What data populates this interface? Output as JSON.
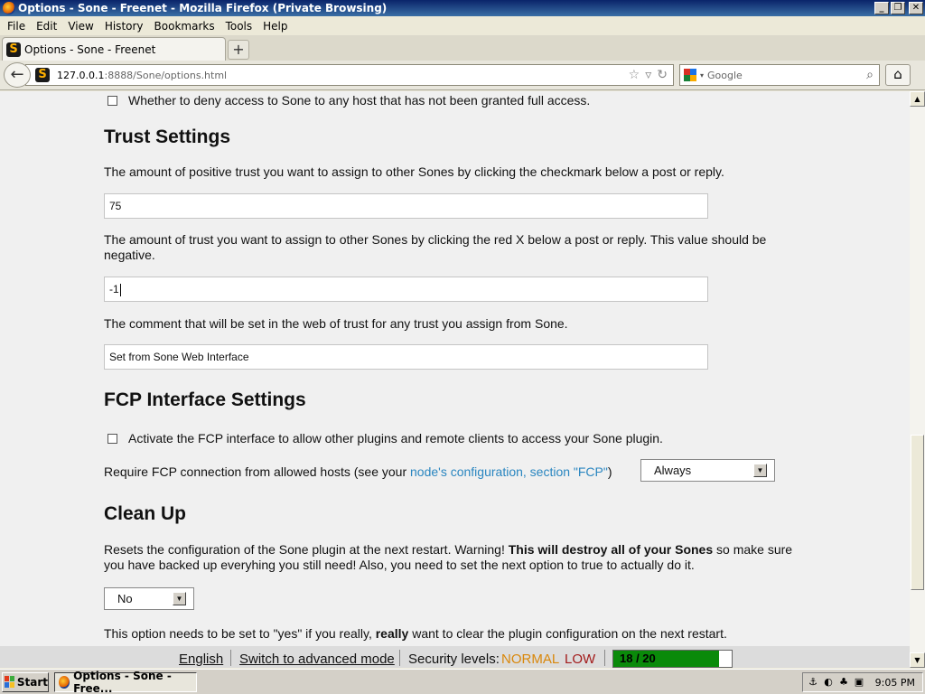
{
  "window": {
    "title": "Options - Sone - Freenet - Mozilla Firefox (Private Browsing)",
    "buttons": [
      "minimize",
      "restore",
      "close"
    ]
  },
  "menubar": {
    "items": [
      {
        "label": "File",
        "accel": "F"
      },
      {
        "label": "Edit",
        "accel": "E"
      },
      {
        "label": "View",
        "accel": "V"
      },
      {
        "label": "History",
        "accel": "s"
      },
      {
        "label": "Bookmarks",
        "accel": "B"
      },
      {
        "label": "Tools",
        "accel": "T"
      },
      {
        "label": "Help",
        "accel": "H"
      }
    ]
  },
  "tabs": [
    {
      "label": "Options - Sone - Freenet",
      "icon": "sone-favicon"
    }
  ],
  "newtab_label": "+",
  "navbar": {
    "url_host": "127.0.0.1",
    "url_rest": ":8888/Sone/options.html",
    "search_placeholder": "Google"
  },
  "content": {
    "deny_access_label": "Whether to deny access to Sone to any host that has not been granted full access.",
    "trust": {
      "heading": "Trust Settings",
      "positive_desc": "The amount of positive trust you want to assign to other Sones by clicking the checkmark below a post or reply.",
      "positive_value": "75",
      "negative_desc": "The amount of trust you want to assign to other Sones by clicking the red X below a post or reply. This value should be negative.",
      "negative_value": "-1",
      "comment_desc": "The comment that will be set in the web of trust for any trust you assign from Sone.",
      "comment_value": "Set from Sone Web Interface"
    },
    "fcp": {
      "heading": "FCP Interface Settings",
      "activate_label": "Activate the FCP interface to allow other plugins and remote clients to access your Sone plugin.",
      "require_prefix": "Require FCP connection from allowed hosts (see your ",
      "require_link": "node's configuration, section \"FCP\"",
      "require_suffix": ")",
      "require_value": "Always"
    },
    "cleanup": {
      "heading": "Clean Up",
      "desc_1": "Resets the configuration of the Sone plugin at the next restart. Warning! ",
      "desc_bold": "This will destroy all of your Sones",
      "desc_2": " so make sure you have backed up everyhing you still need! Also, you need to set the next option to true to actually do it.",
      "select_value": "No",
      "option_1": "This option needs to be set to \"yes\" if you really, ",
      "option_bold": "really",
      "option_2": " want to clear the plugin configuration on the next restart."
    }
  },
  "statusbar": {
    "language": "English",
    "mode": "Switch to advanced mode",
    "security_label": "Security levels:",
    "security_network": "NORMAL",
    "security_friends": "LOW",
    "peers_text": "18 / 20",
    "peers_fraction": 0.89
  },
  "taskbar": {
    "start_label": "Start",
    "task_label": "Options - Sone - Free...",
    "clock": "9:05 PM"
  }
}
